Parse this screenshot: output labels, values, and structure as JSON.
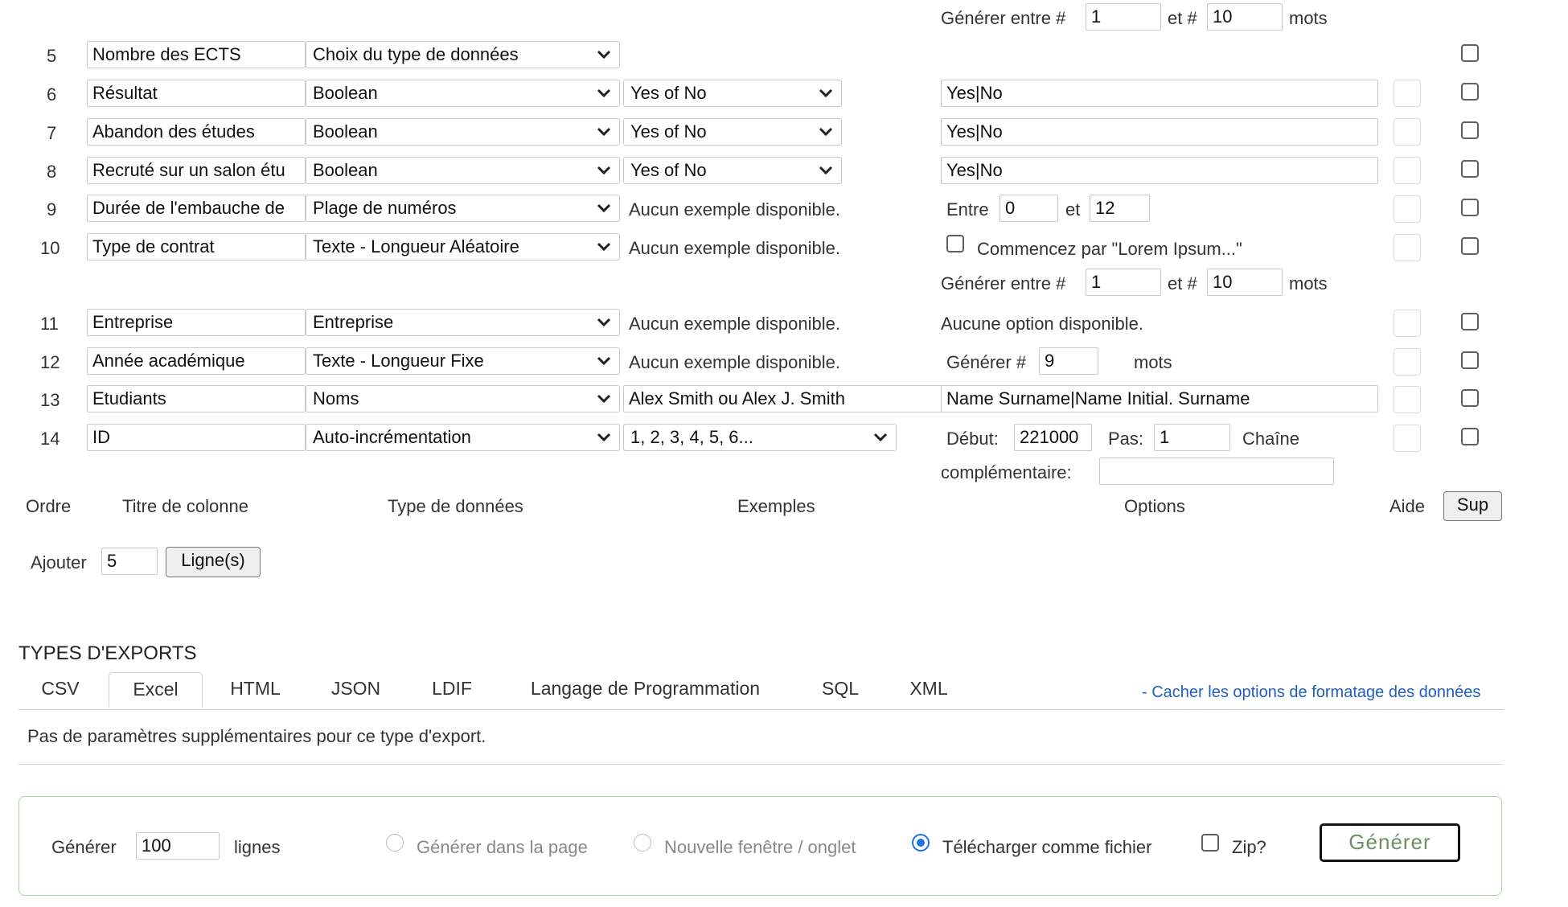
{
  "top_row": {
    "generate_between": "Générer entre #",
    "from": "1",
    "and": "et #",
    "to": "10",
    "words": "mots"
  },
  "rows": [
    {
      "order": "5",
      "title": "Nombre des ECTS",
      "type": "Choix du type de données"
    },
    {
      "order": "6",
      "title": "Résultat",
      "type": "Boolean",
      "example": "Yes of No",
      "option": "Yes|No"
    },
    {
      "order": "7",
      "title": "Abandon des études",
      "type": "Boolean",
      "example": "Yes of No",
      "option": "Yes|No"
    },
    {
      "order": "8",
      "title": "Recruté sur un salon étu",
      "type": "Boolean",
      "example": "Yes of No",
      "option": "Yes|No"
    },
    {
      "order": "9",
      "title": "Durée de l'embauche de",
      "type": "Plage de numéros",
      "example": "Aucun exemple disponible.",
      "between": "Entre",
      "min": "0",
      "and": "et",
      "max": "12"
    },
    {
      "order": "10",
      "title": "Type de contrat",
      "type": "Texte - Longueur Aléatoire",
      "example": "Aucun exemple disponible.",
      "lorem": "Commencez par \"Lorem Ipsum...\"",
      "generate_between": "Générer entre #",
      "from": "1",
      "and": "et #",
      "to": "10",
      "words": "mots"
    },
    {
      "order": "11",
      "title": "Entreprise",
      "type": "Entreprise",
      "example": "Aucun exemple disponible.",
      "option": "Aucune option disponible."
    },
    {
      "order": "12",
      "title": "Année académique",
      "type": "Texte - Longueur Fixe",
      "example": "Aucun exemple disponible.",
      "generate": "Générer #",
      "count": "9",
      "words": "mots"
    },
    {
      "order": "13",
      "title": "Etudiants",
      "type": "Noms",
      "example": "Alex Smith ou Alex J. Smith",
      "option": "Name Surname|Name Initial. Surname"
    },
    {
      "order": "14",
      "title": "ID",
      "type": "Auto-incrémentation",
      "example": "1, 2, 3, 4, 5, 6...",
      "start_label": "Début:",
      "start": "221000",
      "step_label": "Pas:",
      "step": "1",
      "suffix_label_1": "Chaîne",
      "suffix_label_2": "complémentaire:",
      "suffix": ""
    }
  ],
  "columns": {
    "order": "Ordre",
    "title": "Titre de colonne",
    "type": "Type de données",
    "examples": "Exemples",
    "options": "Options",
    "help": "Aide",
    "delete": "Sup"
  },
  "add": {
    "label": "Ajouter",
    "count": "5",
    "button": "Ligne(s)"
  },
  "exports": {
    "heading": "TYPES D'EXPORTS",
    "tabs": [
      "CSV",
      "Excel",
      "HTML",
      "JSON",
      "LDIF",
      "Langage de Programmation",
      "SQL",
      "XML"
    ],
    "active_tab": "Excel",
    "hide_link": "- Cacher les options de formatage des données",
    "no_params": "Pas de paramètres supplémentaires pour ce type d'export."
  },
  "generate": {
    "label": "Générer",
    "rows": "100",
    "rows_unit": "lignes",
    "opt_page": "Générer dans la page",
    "opt_window": "Nouvelle fenêtre / onglet",
    "opt_download": "Télécharger comme fichier",
    "zip": "Zip?",
    "button": "Générer"
  },
  "colors": {
    "accent": "#1a73e8",
    "link": "#1f5fbf",
    "panel_border": "#a8d5a2",
    "button_text": "#6d8f63"
  }
}
